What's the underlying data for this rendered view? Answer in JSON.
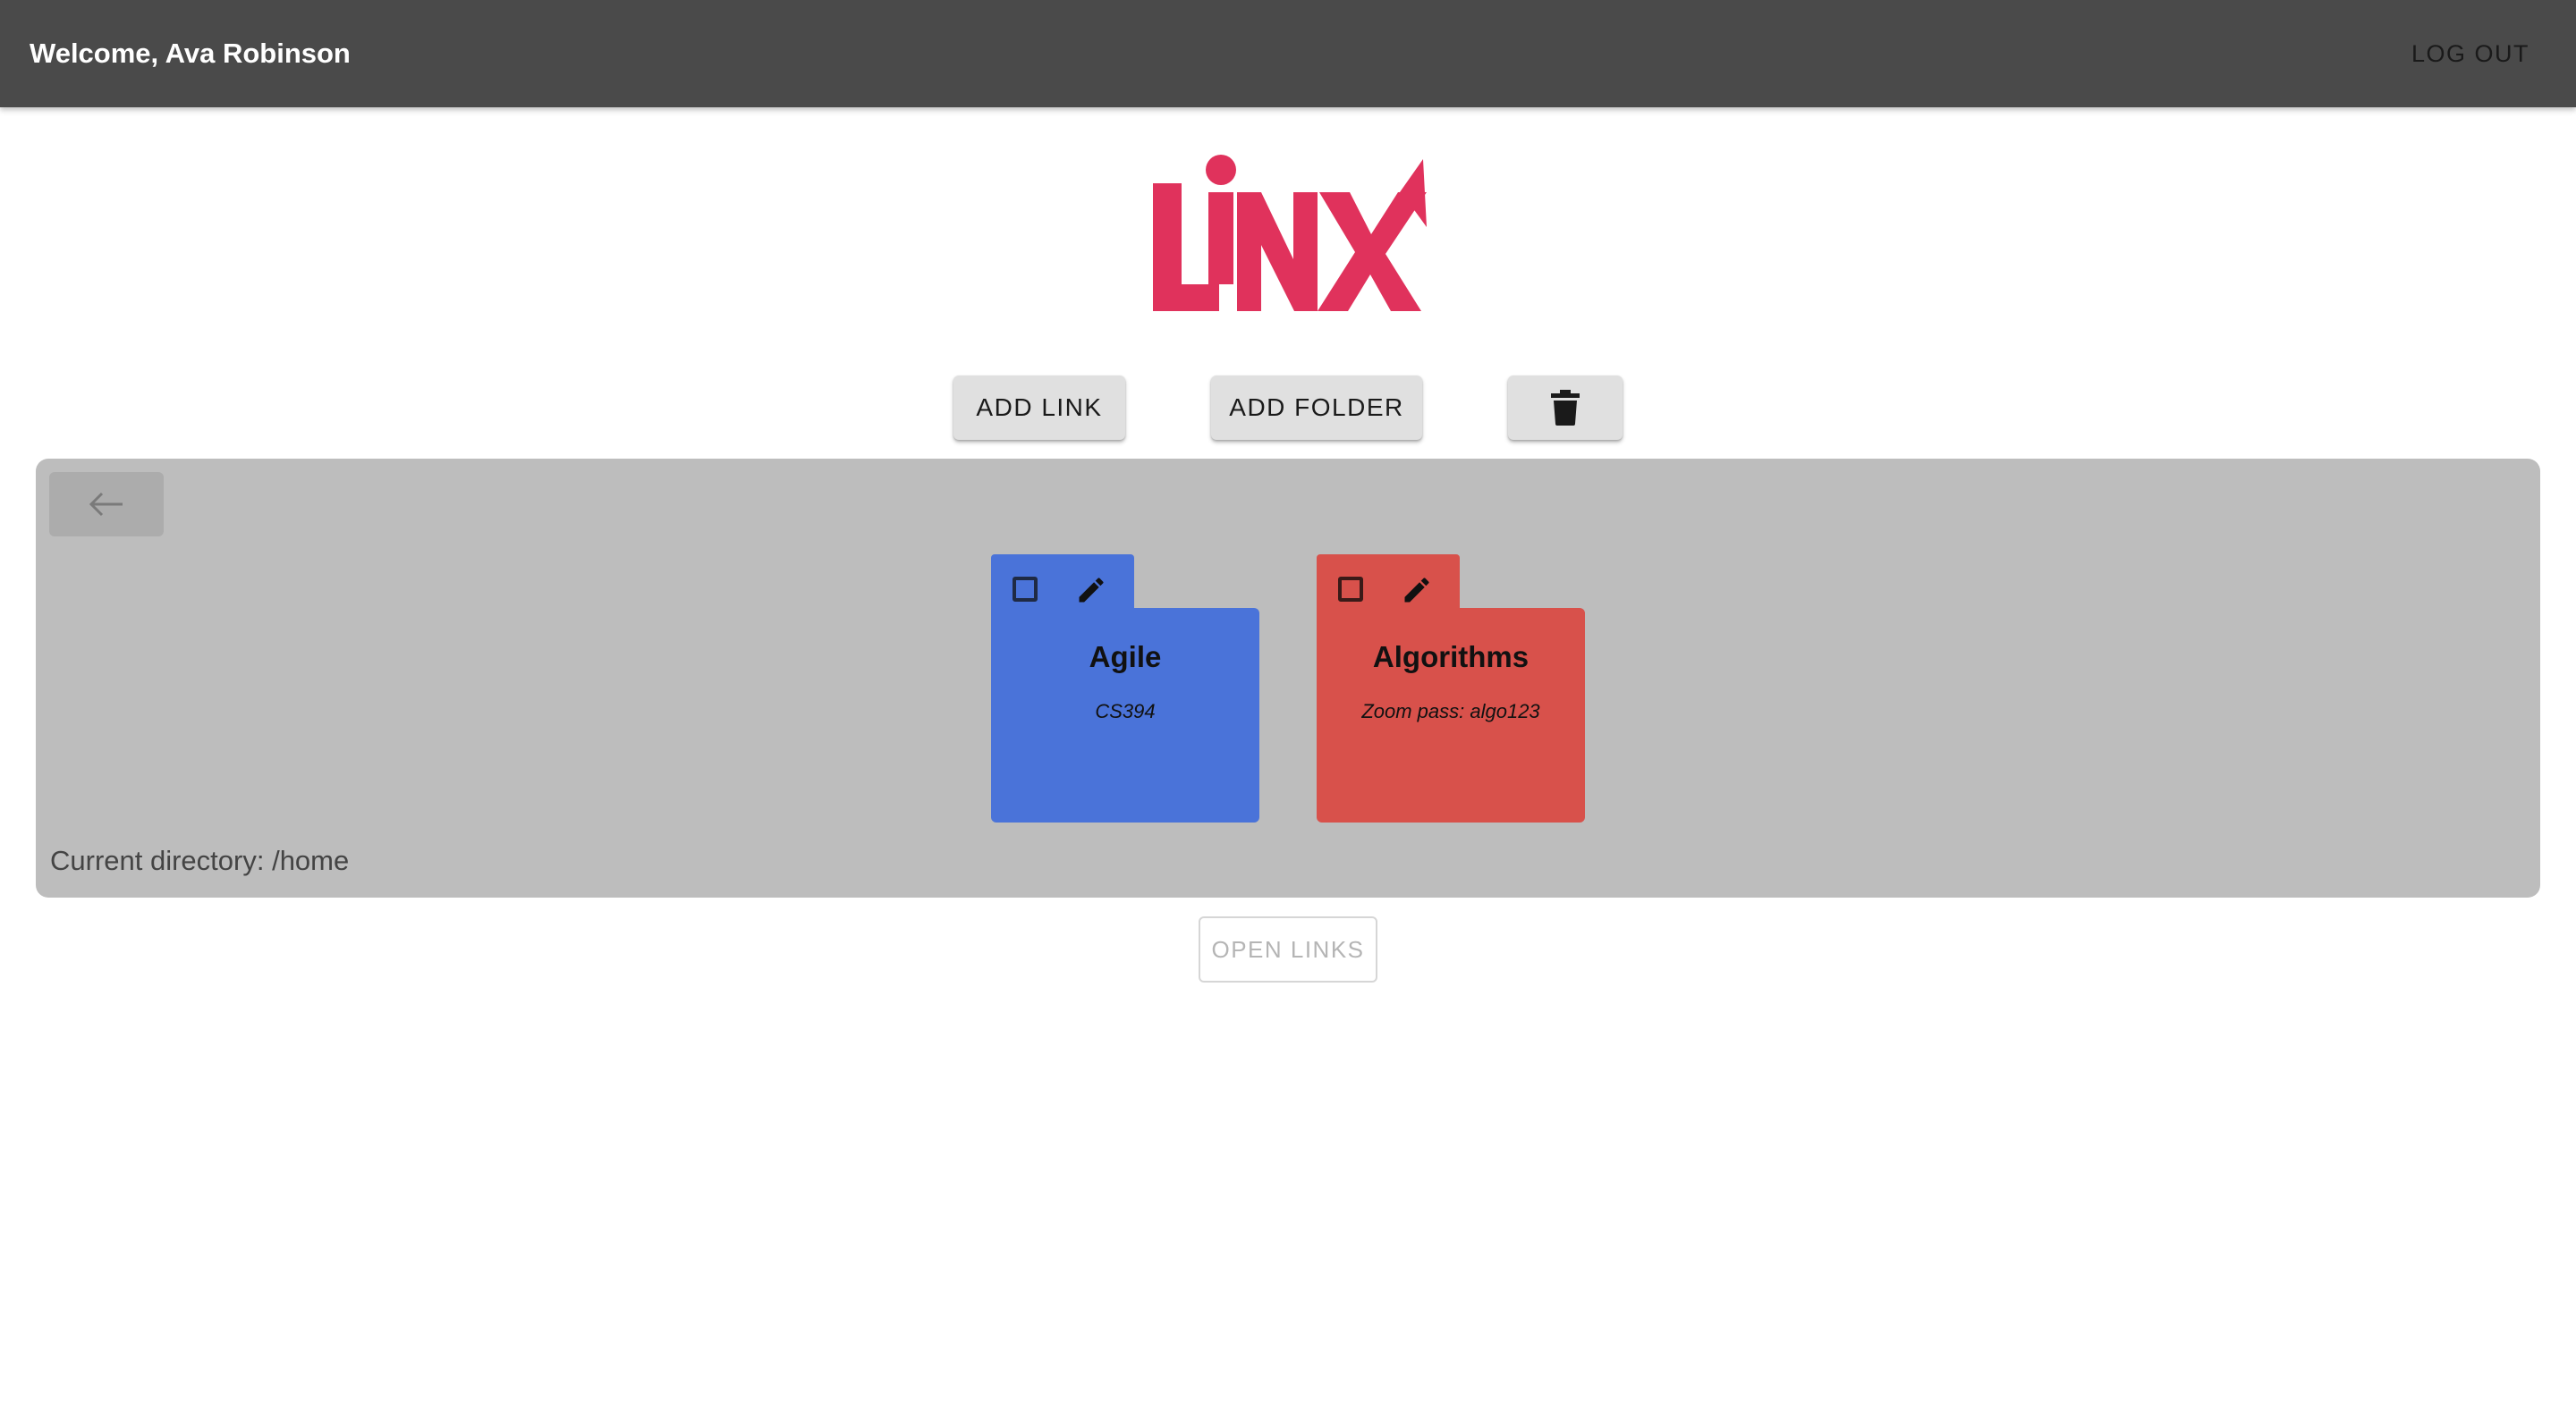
{
  "header": {
    "welcome_text": "Welcome, Ava Robinson",
    "logout_label": "LOG OUT"
  },
  "logo": {
    "text": "LINX",
    "color": "#e0325c"
  },
  "toolbar": {
    "add_link_label": "ADD LINK",
    "add_folder_label": "ADD FOLDER",
    "delete_icon": "trash-icon"
  },
  "browser": {
    "back_icon": "arrow-left-icon",
    "folders": [
      {
        "name": "Agile",
        "description": "CS394",
        "color": "#4a73d9",
        "checked": false,
        "edit_icon": "pencil-icon"
      },
      {
        "name": "Algorithms",
        "description": "Zoom pass: algo123",
        "color": "#d8514b",
        "checked": false,
        "edit_icon": "pencil-icon"
      }
    ],
    "current_directory": "Current directory: /home"
  },
  "actions": {
    "open_links_label": "OPEN LINKS",
    "open_links_enabled": false
  },
  "colors": {
    "topbar": "#4a4a4a",
    "panel": "#bdbdbd",
    "button": "#e0e0e0"
  }
}
